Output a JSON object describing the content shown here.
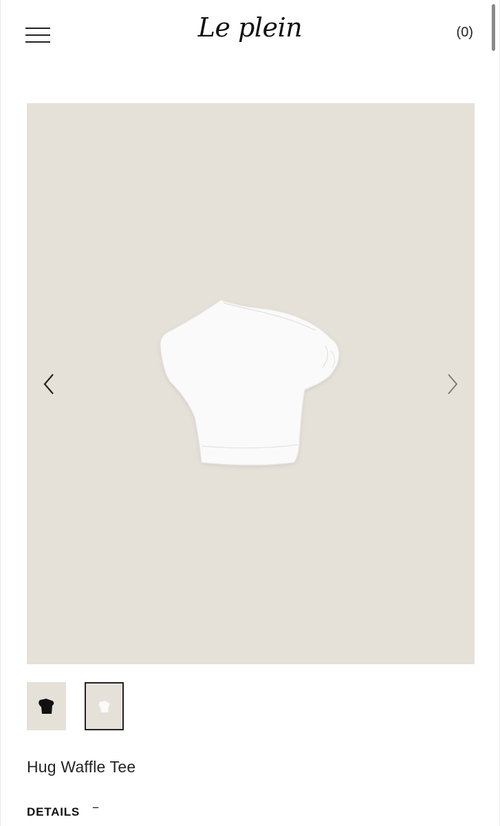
{
  "header": {
    "logo": "Le plein",
    "cart_count": "(0)"
  },
  "gallery": {
    "background": "#e5e1d9",
    "prev_icon": "chevron-left-icon",
    "next_icon": "chevron-right-icon",
    "thumbnails": [
      {
        "color": "black",
        "selected": false
      },
      {
        "color": "white",
        "selected": true
      }
    ]
  },
  "product": {
    "name": "Hug Waffle Tee"
  },
  "details": {
    "label": "DETAILS",
    "toggle": "−"
  }
}
